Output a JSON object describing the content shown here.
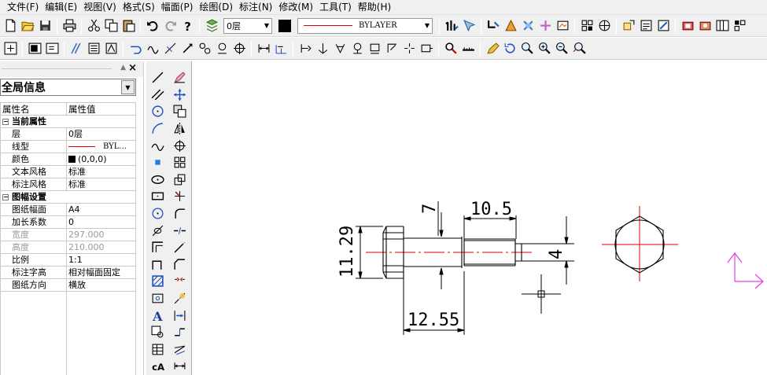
{
  "menu": [
    "文件(F)",
    "编辑(E)",
    "视图(V)",
    "格式(S)",
    "幅面(P)",
    "绘图(D)",
    "标注(N)",
    "修改(M)",
    "工具(T)",
    "帮助(H)"
  ],
  "toolbar": {
    "layer_value": "0层",
    "color_value": "#000000",
    "linetype_value": "BYLAYER"
  },
  "properties": {
    "object_type": "全局信息",
    "header_name": "属性名",
    "header_value": "属性值",
    "group_current": "当前属性",
    "layer_label": "层",
    "layer_value": "0层",
    "linetype_label": "线型",
    "linetype_value": "BYL...",
    "color_label": "颜色",
    "color_value": "(0,0,0)",
    "textstyle_label": "文本风格",
    "textstyle_value": "标准",
    "dimstyle_label": "标注风格",
    "dimstyle_value": "标准",
    "group_sheet": "图幅设置",
    "sheet_label": "图纸幅面",
    "sheet_value": "A4",
    "extend_label": "加长系数",
    "extend_value": "0",
    "width_label": "宽度",
    "width_value": "297.000",
    "height_label": "高度",
    "height_value": "210.000",
    "scale_label": "比例",
    "scale_value": "1:1",
    "dimheight_label": "标注字高",
    "dimheight_value": "相对幅面固定",
    "orient_label": "图纸方向",
    "orient_value": "横放"
  },
  "drawing": {
    "dims": {
      "height_left": "11.29",
      "top_small": "7",
      "top_length": "10.5",
      "right_dia": "4",
      "bottom_length": "12.55"
    }
  },
  "colors": {
    "centerline": "#e00000",
    "ucs": "#e040e0",
    "ui_bg": "#f0f0f0"
  }
}
